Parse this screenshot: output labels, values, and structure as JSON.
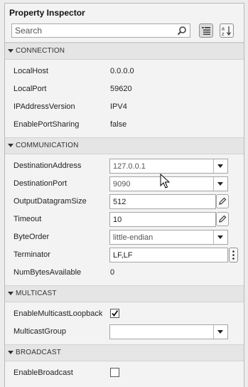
{
  "window": {
    "title": "Property Inspector"
  },
  "search": {
    "placeholder": "Search",
    "value": ""
  },
  "toolbar": {
    "group_icon": "categorized-view-icon",
    "sort_icon": "sort-alphabetical-icon"
  },
  "sections": {
    "connection": {
      "title": "CONNECTION",
      "rows": [
        {
          "label": "LocalHost",
          "value": "0.0.0.0"
        },
        {
          "label": "LocalPort",
          "value": "59620"
        },
        {
          "label": "IPAddressVersion",
          "value": "IPV4"
        },
        {
          "label": "EnablePortSharing",
          "value": "false"
        }
      ]
    },
    "communication": {
      "title": "COMMUNICATION",
      "rows": [
        {
          "label": "DestinationAddress",
          "value": "127.0.0.1"
        },
        {
          "label": "DestinationPort",
          "value": "9090"
        },
        {
          "label": "OutputDatagramSize",
          "value": "512"
        },
        {
          "label": "Timeout",
          "value": "10"
        },
        {
          "label": "ByteOrder",
          "value": "little-endian"
        },
        {
          "label": "Terminator",
          "value": "LF,LF"
        },
        {
          "label": "NumBytesAvailable",
          "value": "0"
        }
      ]
    },
    "multicast": {
      "title": "MULTICAST",
      "rows": [
        {
          "label": "EnableMulticastLoopback",
          "checked": true
        },
        {
          "label": "MulticastGroup",
          "value": ""
        }
      ]
    },
    "broadcast": {
      "title": "BROADCAST",
      "rows": [
        {
          "label": "EnableBroadcast",
          "checked": false
        }
      ]
    }
  }
}
